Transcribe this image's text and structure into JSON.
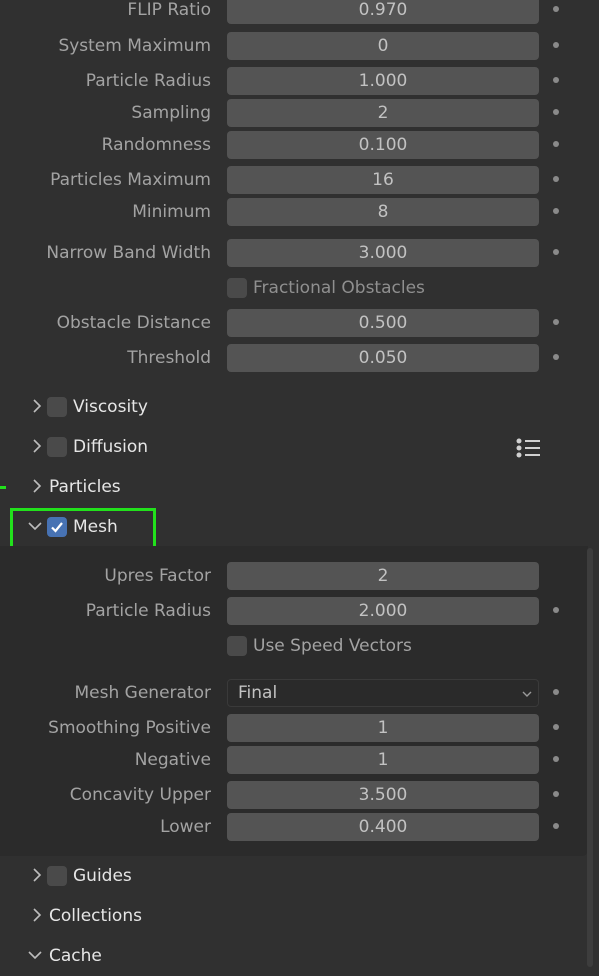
{
  "fluid": {
    "flip_ratio": {
      "label": "FLIP Ratio",
      "value": "0.970"
    },
    "system_maximum": {
      "label": "System Maximum",
      "value": "0"
    },
    "particle_radius": {
      "label": "Particle Radius",
      "value": "1.000"
    },
    "sampling": {
      "label": "Sampling",
      "value": "2"
    },
    "randomness": {
      "label": "Randomness",
      "value": "0.100"
    },
    "particles_maximum": {
      "label": "Particles Maximum",
      "value": "16"
    },
    "minimum": {
      "label": "Minimum",
      "value": "8"
    },
    "narrow_band_width": {
      "label": "Narrow Band Width",
      "value": "3.000"
    },
    "fractional_obstacles": {
      "label": "Fractional Obstacles",
      "checked": false
    },
    "obstacle_distance": {
      "label": "Obstacle Distance",
      "value": "0.500"
    },
    "threshold": {
      "label": "Threshold",
      "value": "0.050"
    }
  },
  "panels": {
    "viscosity": "Viscosity",
    "diffusion": "Diffusion",
    "particles": "Particles",
    "mesh": "Mesh",
    "guides": "Guides",
    "collections": "Collections",
    "cache": "Cache"
  },
  "mesh": {
    "upres_factor": {
      "label": "Upres Factor",
      "value": "2"
    },
    "particle_radius": {
      "label": "Particle Radius",
      "value": "2.000"
    },
    "use_speed_vectors": {
      "label": "Use Speed Vectors",
      "checked": false
    },
    "mesh_generator": {
      "label": "Mesh Generator",
      "value": "Final"
    },
    "smoothing_positive": {
      "label": "Smoothing Positive",
      "value": "1"
    },
    "negative": {
      "label": "Negative",
      "value": "1"
    },
    "concavity_upper": {
      "label": "Concavity Upper",
      "value": "3.500"
    },
    "lower": {
      "label": "Lower",
      "value": "0.400"
    }
  },
  "colors": {
    "accent": "#4772b3",
    "highlight": "#22e11c",
    "background": "#303030"
  }
}
